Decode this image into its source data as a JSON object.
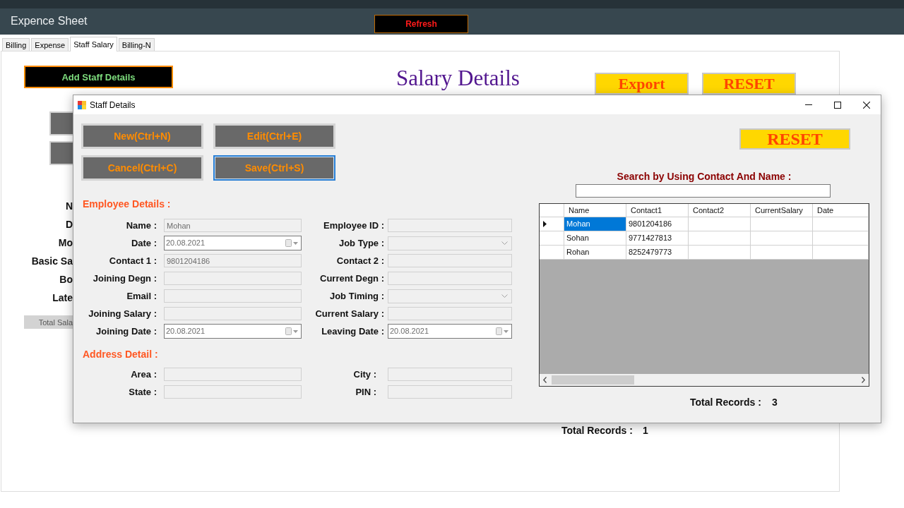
{
  "window": {
    "title": "Expence Sheet"
  },
  "header": {
    "refresh_button": "Refresh"
  },
  "tabs": [
    {
      "label": "Billing",
      "selected": false
    },
    {
      "label": "Expense",
      "selected": false
    },
    {
      "label": "Staff Salary",
      "selected": true
    },
    {
      "label": "Billing-N",
      "selected": false
    }
  ],
  "salary_page": {
    "add_button": "Add Staff Details",
    "title": "Salary Details",
    "export_button": "Export",
    "reset_button": "RESET",
    "labels": [
      "N",
      "D",
      "Mo",
      "Basic Sa",
      "Bo",
      "Late"
    ],
    "total_button": "Total Sala",
    "total_records": {
      "label": "Total Records :",
      "value": "1"
    }
  },
  "dialog": {
    "title": "Staff Details",
    "actions": [
      {
        "label": "New(Ctrl+N)",
        "focused": false
      },
      {
        "label": "Edit(Ctrl+E)",
        "focused": false
      },
      {
        "label": "Cancel(Ctrl+C)",
        "focused": false
      },
      {
        "label": "Save(Ctrl+S)",
        "focused": true
      }
    ],
    "employee_section": "Employee Details :",
    "employee_fields": [
      {
        "label": "Name :",
        "kind": "text",
        "value": "Mohan",
        "disabled": true
      },
      {
        "label": "Employee ID :",
        "kind": "text",
        "disabled": true
      },
      {
        "label": "Date :",
        "kind": "date",
        "value": "20.08.2021",
        "disabled": false
      },
      {
        "label": "Job Type :",
        "kind": "combo",
        "disabled": true
      },
      {
        "label": "Contact 1 :",
        "kind": "text",
        "value": "9801204186",
        "disabled": true
      },
      {
        "label": "Contact 2 :",
        "kind": "text",
        "disabled": true
      },
      {
        "label": "Joining Degn :",
        "kind": "text",
        "disabled": true
      },
      {
        "label": "Current Degn :",
        "kind": "text",
        "disabled": true
      },
      {
        "label": "Email :",
        "kind": "text",
        "disabled": true
      },
      {
        "label": "Job Timing :",
        "kind": "combo",
        "disabled": true
      },
      {
        "label": "Joining Salary :",
        "kind": "text",
        "disabled": true
      },
      {
        "label": "Current Salary :",
        "kind": "text",
        "disabled": true
      },
      {
        "label": "Joining Date :",
        "kind": "date",
        "value": "20.08.2021",
        "disabled": false
      },
      {
        "label": "Leaving Date :",
        "kind": "date",
        "value": "20.08.2021",
        "disabled": false
      }
    ],
    "address_section": "Address Detail :",
    "address_fields": [
      {
        "label": "Area :",
        "kind": "text",
        "disabled": true
      },
      {
        "label": "City :",
        "kind": "text",
        "disabled": true
      },
      {
        "label": "State :",
        "kind": "text",
        "disabled": true
      },
      {
        "label": "PIN :",
        "kind": "text",
        "disabled": true
      }
    ],
    "reset_button": "RESET",
    "search": {
      "label": "Search by Using Contact And Name :"
    },
    "table": {
      "columns": [
        "Name",
        "Contact1",
        "Contact2",
        "CurrentSalary",
        "Date"
      ],
      "rows": [
        {
          "cells": [
            "Mohan",
            "9801204186"
          ],
          "selected": true
        },
        {
          "cells": [
            "Sohan",
            "9771427813"
          ],
          "selected": false
        },
        {
          "cells": [
            "Rohan",
            "8252479773"
          ],
          "selected": false
        }
      ]
    },
    "total_records": {
      "label": "Total Records :",
      "value": "3"
    }
  }
}
